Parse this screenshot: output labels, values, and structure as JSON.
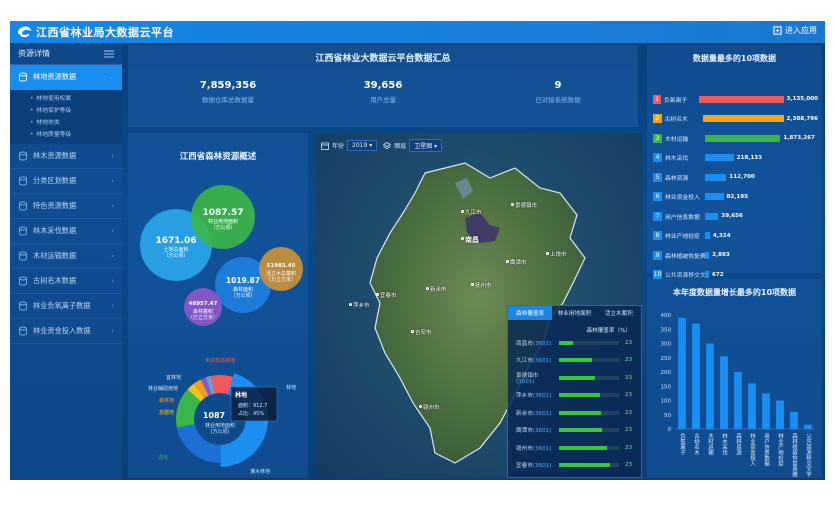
{
  "header": {
    "title": "江西省林业局大数据云平台",
    "enter_label": "进入应用"
  },
  "sidebar": {
    "title": "资源详情",
    "items": [
      {
        "label": "林地资源数据",
        "active": true,
        "subitems": [
          "林地使用权属",
          "林地保护等级",
          "林地地类",
          "林地质量等级"
        ]
      },
      {
        "label": "林木资源数据"
      },
      {
        "label": "分类区划数据"
      },
      {
        "label": "特色资源数据"
      },
      {
        "label": "林木采伐数据"
      },
      {
        "label": "木材运输数据"
      },
      {
        "label": "古树名木数据"
      },
      {
        "label": "林业负氧离子数据"
      },
      {
        "label": "林业资金投入数据"
      }
    ]
  },
  "summary": {
    "title": "江西省林业大数据云平台数据汇总",
    "stats": [
      {
        "value": "7,859,356",
        "label": "数据仓库总数据量"
      },
      {
        "value": "39,656",
        "label": "用户总量"
      },
      {
        "value": "9",
        "label": "已对接系统数据"
      }
    ]
  },
  "overview": {
    "title": "江西省森林资源概述",
    "bubbles": [
      {
        "value": "1671.06",
        "label1": "土地总面积",
        "label2": "（万公顷）",
        "color": "#2aa6e8"
      },
      {
        "value": "1087.57",
        "label1": "林业用地面积",
        "label2": "（万公顷）",
        "color": "#3bb54a"
      },
      {
        "value": "1019.87",
        "label1": "森林面积",
        "label2": "（万公顷）",
        "color": "#1f7fe0"
      },
      {
        "value": "51985.45",
        "label1": "活立木总蓄积",
        "label2": "（万立方米）",
        "color": "#c9903a"
      },
      {
        "value": "48957.47",
        "label1": "森林蓄积",
        "label2": "（万立方米）",
        "color": "#8a58c8"
      }
    ],
    "donut": {
      "center_value": "1087",
      "center_label1": "林业用地面积",
      "center_label2": "(万公顷)",
      "tooltip": {
        "title": "林地",
        "area": "面积：912.7",
        "ratio": "占比：45%"
      },
      "labels": [
        "未成林造林地",
        "宜林地",
        "林业辅助用地",
        "森林地",
        "苗圃地",
        "迹地",
        "灌木林地",
        "林地"
      ],
      "segments": [
        {
          "name": "林地",
          "value": 45,
          "color": "#1b8ef2"
        },
        {
          "name": "灌木林地",
          "value": 22,
          "color": "#1c6fd6"
        },
        {
          "name": "迹地",
          "value": 15,
          "color": "#39b54a"
        },
        {
          "name": "苗圃地",
          "value": 3,
          "color": "#f2c21b"
        },
        {
          "name": "森林地",
          "value": 3,
          "color": "#f59a23"
        },
        {
          "name": "林业辅助用地",
          "value": 2,
          "color": "#7b5bd6"
        },
        {
          "name": "宜林地",
          "value": 2,
          "color": "#7a9bc8"
        },
        {
          "name": "未成林造林地",
          "value": 8,
          "color": "#f25a5a"
        }
      ]
    }
  },
  "map": {
    "toolbar": {
      "year_label": "年份",
      "year_value": "2019",
      "layer_label": "图层",
      "layer_value": "卫星图"
    },
    "cities": [
      "九江市",
      "景德镇市",
      "南昌",
      "鹰潭市",
      "上饶市",
      "新余市",
      "宜春市",
      "萍乡市",
      "抚州市",
      "吉安市",
      "赣州市"
    ],
    "tabs": [
      "森林覆盖率",
      "林业用地面积",
      "活立木蓄积"
    ],
    "table_header": "森林覆盖率（%）",
    "rows": [
      {
        "name": "南昌市",
        "code": "(3601)",
        "value": 23,
        "pct": 0.23
      },
      {
        "name": "九江市",
        "code": "(3601)",
        "value": 23,
        "pct": 0.55
      },
      {
        "name": "景德镇市",
        "code": "(3601)",
        "value": 23,
        "pct": 0.6
      },
      {
        "name": "萍乡市",
        "code": "(3601)",
        "value": 23,
        "pct": 0.68
      },
      {
        "name": "新余市",
        "code": "(3601)",
        "value": 23,
        "pct": 0.7
      },
      {
        "name": "鹰潭市",
        "code": "(3601)",
        "value": 23,
        "pct": 0.72
      },
      {
        "name": "赣州市",
        "code": "(3601)",
        "value": 23,
        "pct": 0.8
      },
      {
        "name": "宜春市",
        "code": "(3601)",
        "value": 23,
        "pct": 0.85
      }
    ]
  },
  "top10": {
    "title": "数据量最多的10项数据",
    "colors": {
      "1": "#f25a5a",
      "2": "#f2a51b",
      "3": "#3bb54a",
      "other": "#1b8ef2"
    },
    "items": [
      {
        "rank": "1",
        "name": "负氧离子",
        "value": "3,135,000",
        "raw": 3135000
      },
      {
        "rank": "2",
        "name": "古树名木",
        "value": "2,388,796",
        "raw": 2388796
      },
      {
        "rank": "3",
        "name": "木材运输",
        "value": "1,873,267",
        "raw": 1873267
      },
      {
        "rank": "4",
        "name": "林木采伐",
        "value": "218,133",
        "raw": 218133
      },
      {
        "rank": "5",
        "name": "森林资源",
        "value": "112,700",
        "raw": 112700
      },
      {
        "rank": "6",
        "name": "林业资金投入",
        "value": "82,195",
        "raw": 82195
      },
      {
        "rank": "7",
        "name": "用户信息数据",
        "value": "39,656",
        "raw": 39656
      },
      {
        "rank": "8",
        "name": "林业产地检疫",
        "value": "4,324",
        "raw": 4324
      },
      {
        "rank": "9",
        "name": "森林植被恢复费缴交",
        "value": "2,893",
        "raw": 2893
      },
      {
        "rank": "10",
        "name": "公共资源移交文字",
        "value": "672",
        "raw": 672
      }
    ]
  },
  "chart_data": {
    "type": "bar",
    "title": "本年度数据量增长最多的10项数据",
    "categories": [
      "负氧离子",
      "古树名木",
      "木材运输",
      "林木采伐",
      "森林资源",
      "林业资金投入",
      "用户信息数据",
      "林业产地检疫",
      "森林植被恢复费缴交",
      "公共资源移交文字"
    ],
    "values": [
      390,
      370,
      300,
      255,
      200,
      160,
      125,
      100,
      60,
      15
    ],
    "ylim": [
      0,
      400
    ],
    "yticks": [
      "0",
      "50",
      "100",
      "150",
      "200",
      "250",
      "300",
      "350",
      "400"
    ],
    "color": "#1b8ef2"
  }
}
